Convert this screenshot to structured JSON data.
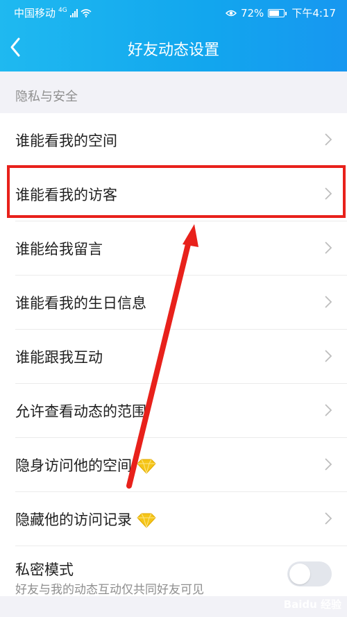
{
  "status_bar": {
    "carrier": "中国移动",
    "network": "4G",
    "battery": "72%",
    "battery_level": 0.72,
    "time": "下午4:17"
  },
  "nav": {
    "title": "好友动态设置",
    "back_icon": "chevron-left-icon"
  },
  "section": {
    "title": "隐私与安全"
  },
  "rows": [
    {
      "label": "谁能看我的空间"
    },
    {
      "label": "谁能看我的访客"
    },
    {
      "label": "谁能给我留言"
    },
    {
      "label": "谁能看我的生日信息"
    },
    {
      "label": "谁能跟我互动"
    },
    {
      "label": "允许查看动态的范围"
    },
    {
      "label": "隐身访问他的空间",
      "icon": "diamond-icon"
    },
    {
      "label": "隐藏他的访问记录",
      "icon": "diamond-icon"
    }
  ],
  "private_mode": {
    "label": "私密模式",
    "description": "好友与我的动态互动仅共同好友可见",
    "enabled": false
  },
  "colors": {
    "header_start": "#1fb9f0",
    "header_end": "#1797f0",
    "annotation_red": "#e8211b",
    "diamond_gold": "#f5c518"
  },
  "watermark": "Baidu 经验"
}
